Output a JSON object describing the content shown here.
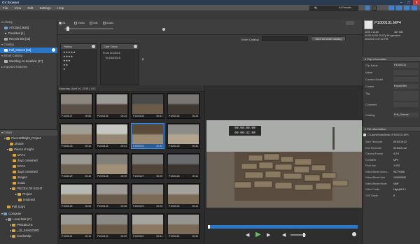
{
  "window": {
    "title": "GV Browser",
    "min": "–",
    "max": "□",
    "close": "✕"
  },
  "menu": [
    "File",
    "View",
    "Edit",
    "Settings",
    "Help"
  ],
  "search": {
    "value": "",
    "results_label": "64 Results"
  },
  "filter": {
    "all": "All",
    "video": "Video",
    "still": "Still",
    "audio": "Audio"
  },
  "library": {
    "header": "Library",
    "all_clips": "All Clips [2635]",
    "favorites": "Favorites [1]",
    "recycle": "Recycle Bin [42]",
    "catalog_header": "Catalog",
    "catalog_item": "Pull_Greece [64]",
    "smart_header": "Smart Catalog",
    "smart_item": "Wedding in Heraklion [17]",
    "imported": "Imported Histories"
  },
  "filters_panel": {
    "rating_label": "Rating",
    "date_label": "Date Taken",
    "from": "From 2/1/2015",
    "to": "To 6/30/2015",
    "add": "+",
    "smart_catalog": "Smart Catalog",
    "save_smart": "Save as smart catalog"
  },
  "folder": {
    "header": "Folder",
    "items": [
      "PiecesOfEight_Project",
      "photos",
      "Pieces of eight",
      "DAY1",
      "day1 converted",
      "DAY2",
      "day2 converted",
      "images",
      "music",
      "PIECES OF EIGHT",
      "Project",
      "rendered",
      "Pull_Day2"
    ],
    "computer": "Computer",
    "local_disk": "Local Disk (C:)",
    "projects": "PROJECTS",
    "js_shadow": "_JS_SHADOWO",
    "cache": "iCacheClip"
  },
  "grid": {
    "date_header": "Saturday, April 04, 2015 [ 42 ]",
    "clips": [
      {
        "name": "P1000137",
        "dur": "00:56"
      },
      {
        "name": "P1000136",
        "dur": "00:24"
      },
      {
        "name": "P1000135",
        "dur": "00:31"
      },
      {
        "name": "P1000134",
        "dur": "00:26"
      },
      {
        "name": "P1000133",
        "dur": "00:10"
      },
      {
        "name": "P1000132",
        "dur": "00:41"
      },
      {
        "name": "P1000131",
        "dur": "00:42"
      },
      {
        "name": "P1000130",
        "dur": "00:32"
      },
      {
        "name": "P1000129",
        "dur": "00:33"
      },
      {
        "name": "P1000128",
        "dur": "00:39"
      },
      {
        "name": "P1000127",
        "dur": "00:28"
      },
      {
        "name": "P1000126",
        "dur": "00:11"
      },
      {
        "name": "P1000125",
        "dur": "00:54"
      },
      {
        "name": "P1000124",
        "dur": "00:38"
      },
      {
        "name": "P1000123",
        "dur": "00:26"
      },
      {
        "name": "P1000122",
        "dur": "00:44"
      },
      {
        "name": "P1000121",
        "dur": "00:19"
      },
      {
        "name": "P1000120",
        "dur": "00:29"
      },
      {
        "name": "P1000119",
        "dur": "00:34"
      },
      {
        "name": "P1000118",
        "dur": "00:36"
      }
    ]
  },
  "preview": {
    "tc1": "00:00:00:00",
    "tc2": "00:00:42:00"
  },
  "clipinfo_top": {
    "name": "P1000131.MP4",
    "res": "4096 x 2160",
    "size": "487 MB",
    "fps": "00:00:42:00   29.97p   Progressive",
    "date": "4/4/2015 1:47:22 PM"
  },
  "clip_information": {
    "header": "Clip Information",
    "rows": [
      {
        "k": "Clip Name",
        "v": "P1000131"
      },
      {
        "k": "Maker",
        "v": ""
      },
      {
        "k": "Camera Model",
        "v": ""
      },
      {
        "k": "Creator",
        "v": "RoyalOffer"
      },
      {
        "k": "Tag",
        "v": ""
      },
      {
        "k": "Comment",
        "v": ""
      },
      {
        "k": "Catalog",
        "v": "Pull_Greece"
      }
    ]
  },
  "file_information": {
    "header": "File Information",
    "path": "C:\\Users\\Kosta\\Deskt..\\P1000131.MP4",
    "rows": [
      {
        "k": "Start Timecode",
        "v": "00:53:19:12"
      },
      {
        "k": "End Timecode",
        "v": "00:54:01:12"
      },
      {
        "k": "Chroma Format",
        "v": "4:2:0"
      },
      {
        "k": "Container",
        "v": "MP4"
      },
      {
        "k": "Pixel Asp.",
        "v": "1.000"
      },
      {
        "k": "Video Bitrate Avera...",
        "v": "95779346"
      },
      {
        "k": "Video Bitrate Max",
        "v": "100000000"
      },
      {
        "k": "Video Bitrate Mode",
        "v": "VBR"
      },
      {
        "k": "Video Profile",
        "v": "High@L5.1"
      },
      {
        "k": "YUV Depth",
        "v": "8"
      }
    ]
  },
  "colors": {
    "accent": "#2a77c9",
    "bg": "#3a3a3a",
    "play": "#5fc35a"
  }
}
